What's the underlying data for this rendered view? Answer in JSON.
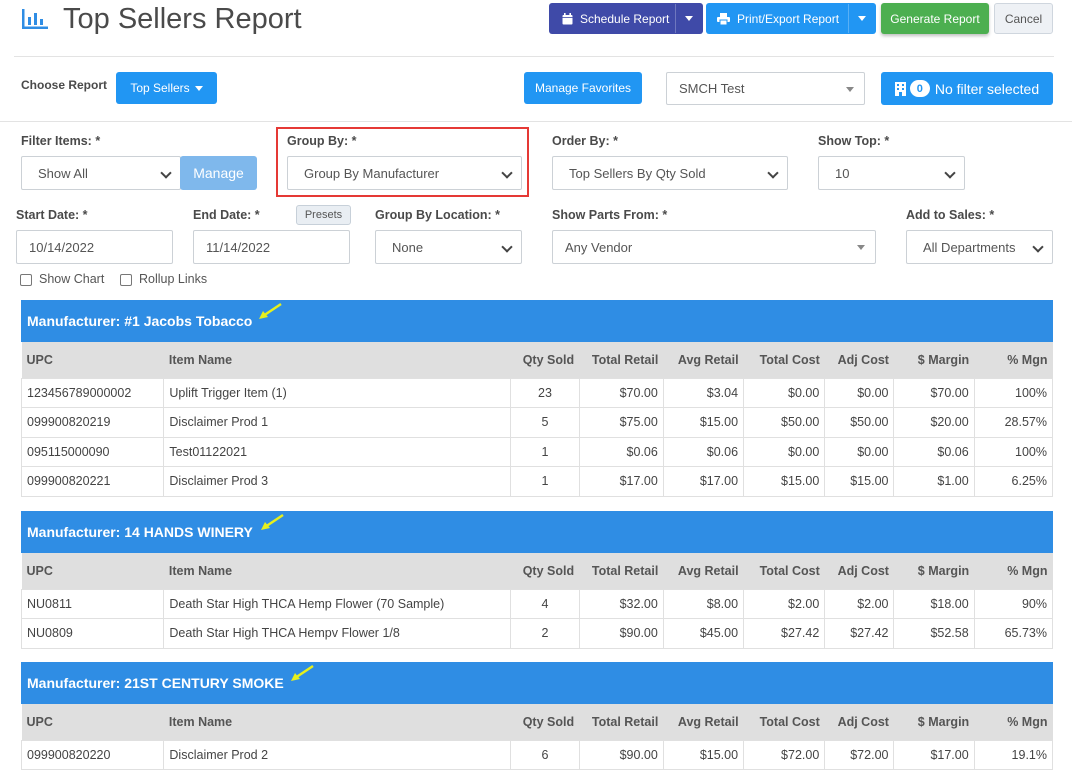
{
  "header": {
    "title": "Top Sellers Report",
    "schedule_label": "Schedule Report",
    "print_label": "Print/Export Report",
    "generate_label": "Generate Report",
    "cancel_label": "Cancel"
  },
  "controls": {
    "choose_report_label": "Choose Report",
    "report_type": "Top Sellers",
    "manage_favorites_label": "Manage Favorites",
    "store_value": "SMCH Test",
    "filter_count": "0",
    "filter_label": "No filter selected"
  },
  "filters": {
    "filter_items_label": "Filter Items: *",
    "filter_items_value": "Show All",
    "manage_label": "Manage",
    "group_by_label": "Group By: *",
    "group_by_value": "Group By Manufacturer",
    "order_by_label": "Order By: *",
    "order_by_value": "Top Sellers By Qty Sold",
    "show_top_label": "Show Top: *",
    "show_top_value": "10",
    "start_date_label": "Start Date: *",
    "start_date_value": "10/14/2022",
    "end_date_label": "End Date: *",
    "end_date_value": "11/14/2022",
    "presets_label": "Presets",
    "group_location_label": "Group By Location: *",
    "group_location_value": "None",
    "parts_from_label": "Show Parts From: *",
    "parts_from_value": "Any Vendor",
    "add_sales_label": "Add to Sales: *",
    "add_sales_value": "All Departments",
    "show_chart_label": "Show Chart",
    "rollup_links_label": "Rollup Links"
  },
  "columns": [
    "UPC",
    "Item Name",
    "Qty Sold",
    "Total Retail",
    "Avg Retail",
    "Total Cost",
    "Adj Cost",
    "$ Margin",
    "% Mgn"
  ],
  "groups": [
    {
      "title": "Manufacturer: #1 Jacobs Tobacco",
      "rows": [
        [
          "123456789000002",
          "Uplift Trigger Item (1)",
          "23",
          "$70.00",
          "$3.04",
          "$0.00",
          "$0.00",
          "$70.00",
          "100%"
        ],
        [
          "099900820219",
          "Disclaimer Prod 1",
          "5",
          "$75.00",
          "$15.00",
          "$50.00",
          "$50.00",
          "$20.00",
          "28.57%"
        ],
        [
          "095115000090",
          "Test01122021",
          "1",
          "$0.06",
          "$0.06",
          "$0.00",
          "$0.00",
          "$0.06",
          "100%"
        ],
        [
          "099900820221",
          "Disclaimer Prod 3",
          "1",
          "$17.00",
          "$17.00",
          "$15.00",
          "$15.00",
          "$1.00",
          "6.25%"
        ]
      ]
    },
    {
      "title": "Manufacturer: 14 HANDS WINERY",
      "rows": [
        [
          "NU0811",
          "Death Star High THCA Hemp Flower (70 Sample)",
          "4",
          "$32.00",
          "$8.00",
          "$2.00",
          "$2.00",
          "$18.00",
          "90%"
        ],
        [
          "NU0809",
          "Death Star High THCA Hempv Flower 1/8",
          "2",
          "$90.00",
          "$45.00",
          "$27.42",
          "$27.42",
          "$52.58",
          "65.73%"
        ]
      ]
    },
    {
      "title": "Manufacturer: 21ST CENTURY SMOKE",
      "rows": [
        [
          "099900820220",
          "Disclaimer Prod 2",
          "6",
          "$90.00",
          "$15.00",
          "$72.00",
          "$72.00",
          "$17.00",
          "19.1%"
        ]
      ]
    }
  ],
  "colors": {
    "group_header": "#2f8de4",
    "highlight_border": "#e53935",
    "arrow": "#e6f01d"
  }
}
